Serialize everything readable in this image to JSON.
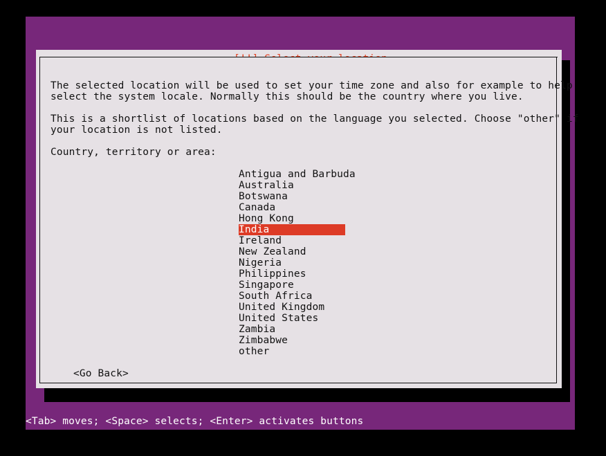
{
  "screen": {
    "background_color": "#000000",
    "backdrop_color": "#77277a",
    "dialog_background_color": "#e6e1e5",
    "accent_color": "#e04020",
    "highlight_background_color": "#dd3b26",
    "highlight_text_color": "#ffffff",
    "text_color": "#111111"
  },
  "dialog": {
    "title": "[!!] Select your location",
    "paragraphs": [
      "The selected location will be used to set your time zone and also for example to help\nselect the system locale. Normally this should be the country where you live.",
      "This is a shortlist of locations based on the language you selected. Choose \"other\" if\nyour location is not listed."
    ],
    "field_label": "Country, territory or area:",
    "selected_value": "India",
    "options": [
      "Antigua and Barbuda",
      "Australia",
      "Botswana",
      "Canada",
      "Hong Kong",
      "India",
      "Ireland",
      "New Zealand",
      "Nigeria",
      "Philippines",
      "Singapore",
      "South Africa",
      "United Kingdom",
      "United States",
      "Zambia",
      "Zimbabwe",
      "other"
    ],
    "go_back_label": "<Go Back>"
  },
  "status_bar": {
    "text": "<Tab> moves; <Space> selects; <Enter> activates buttons"
  }
}
